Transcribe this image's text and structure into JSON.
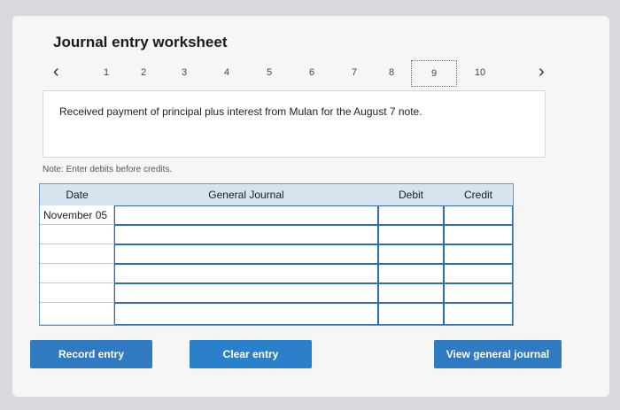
{
  "title": "Journal entry worksheet",
  "pager": {
    "prev_icon": "chevron-left-icon",
    "next_icon": "chevron-right-icon",
    "pages": [
      "1",
      "2",
      "3",
      "4",
      "5",
      "6",
      "7",
      "8",
      "9",
      "10"
    ],
    "active_page": "9"
  },
  "prompt": "Received payment of principal plus interest from Mulan for the August 7 note.",
  "note": "Note: Enter debits before credits.",
  "table": {
    "headers": {
      "date": "Date",
      "journal": "General Journal",
      "debit": "Debit",
      "credit": "Credit"
    },
    "rows": [
      {
        "date": "November 05",
        "journal": "",
        "debit": "",
        "credit": ""
      },
      {
        "date": "",
        "journal": "",
        "debit": "",
        "credit": ""
      },
      {
        "date": "",
        "journal": "",
        "debit": "",
        "credit": ""
      },
      {
        "date": "",
        "journal": "",
        "debit": "",
        "credit": ""
      },
      {
        "date": "",
        "journal": "",
        "debit": "",
        "credit": ""
      },
      {
        "date": "",
        "journal": "",
        "debit": "",
        "credit": ""
      }
    ]
  },
  "buttons": {
    "record": "Record entry",
    "clear": "Clear entry",
    "view": "View general journal"
  },
  "colors": {
    "accent": "#2f7ac0",
    "header_bg": "#d8e3f0"
  }
}
